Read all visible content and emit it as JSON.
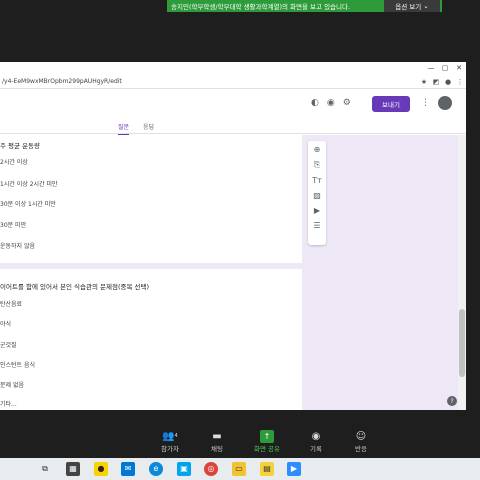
{
  "zoom_banner": {
    "text": "송지민(학부학생/학부대학 생활과학계열)의 화면을 보고 있습니다.",
    "options_label": "옵션 보기",
    "color": "#2e9b3a"
  },
  "browser": {
    "url": "/y4-EeM9wxMBrOpbm299pAUHgyR/edit",
    "window_controls": [
      "—",
      "▢",
      "✕"
    ]
  },
  "forms": {
    "send_label": "보내기",
    "accent": "#673ab7",
    "tabs": [
      {
        "label": "질문",
        "active": true
      },
      {
        "label": "응답",
        "active": false
      }
    ],
    "question1": {
      "title": "주 평균 운동량",
      "options": [
        "2시간 이상",
        "1시간 이상 2시간 미만",
        "30분 이상 1시간 미만",
        "30분 미만",
        "운동하지 않음"
      ]
    },
    "question2": {
      "title": "이어트를 함에 있어서 본인 식습관의 문제점(중복 선택)",
      "options": [
        "탄산음료",
        "야식",
        "군것질",
        "인스턴트 음식",
        "문제 없음",
        "기타..."
      ]
    }
  },
  "zoom_toolbar": [
    {
      "label": "참가자",
      "icon": "participants-icon",
      "count": "4"
    },
    {
      "label": "채팅",
      "icon": "chat-icon"
    },
    {
      "label": "화면 공유",
      "icon": "share-screen-icon"
    },
    {
      "label": "기록",
      "icon": "record-icon"
    },
    {
      "label": "반응",
      "icon": "reaction-icon"
    }
  ]
}
